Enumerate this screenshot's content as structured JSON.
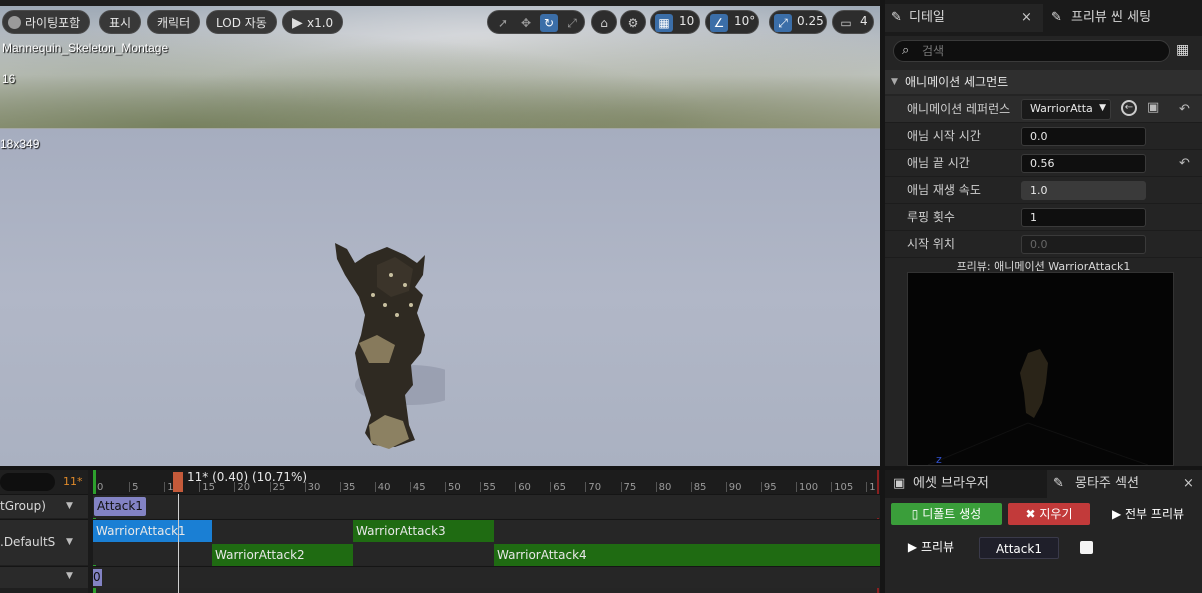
{
  "viewport": {
    "toolbar": {
      "lighting_label": "라이팅포함",
      "show_label": "표시",
      "character_label": "캐릭터",
      "lod_label": "LOD 자동",
      "play_speed": "x1.0",
      "grid_value": "10",
      "rotation_value": "10°",
      "scale_value": "0.25",
      "camera_value": "4"
    },
    "overlay": {
      "asset_name": "Mannequin_Skeleton_Montage",
      "frame_text": "16",
      "resolution_text": "18x349"
    }
  },
  "details_panel": {
    "tabs": [
      {
        "label": "디테일",
        "close": "×"
      },
      {
        "label": "프리뷰 씬 세팅"
      }
    ],
    "search_placeholder": "검색",
    "section_title": "애니메이션 세그먼트",
    "properties": [
      {
        "label": "애니메이션 레퍼런스",
        "value": "WarriorAtta"
      },
      {
        "label": "애님 시작 시간",
        "value": "0.0"
      },
      {
        "label": "애님 끝 시간",
        "value": "0.56"
      },
      {
        "label": "애님 재생 속도",
        "value": "1.0"
      },
      {
        "label": "루핑 횟수",
        "value": "1"
      },
      {
        "label": "시작 위치",
        "value": "0.0"
      }
    ],
    "preview_title": "프리뷰: 애니메이션 WarriorAttack1"
  },
  "timeline": {
    "search_count": "11*",
    "playhead_label": "11* (0.40) (10.71%)",
    "ticks": [
      "0",
      "5",
      "10",
      "15",
      "20",
      "25",
      "30",
      "35",
      "40",
      "45",
      "50",
      "55",
      "60",
      "65",
      "70",
      "75",
      "80",
      "85",
      "90",
      "95",
      "100",
      "105",
      "1"
    ],
    "rows": [
      {
        "label": "tGroup)"
      },
      {
        "label": ".DefaultS"
      },
      {
        "label": ""
      }
    ],
    "section_clip": "Attack1",
    "clips": [
      {
        "label": "WarriorAttack1",
        "color": "#1a7fd4"
      },
      {
        "label": "WarriorAttack2",
        "color": "#1f6b12"
      },
      {
        "label": "WarriorAttack3",
        "color": "#1f6b12"
      },
      {
        "label": "WarriorAttack4",
        "color": "#1f6b12"
      }
    ],
    "notify_marker": "0"
  },
  "bottom_panel": {
    "tabs": [
      {
        "label": "에셋 브라우저"
      },
      {
        "label": "몽타주 섹션",
        "close": "×"
      }
    ],
    "create_default_label": "디폴트 생성",
    "clear_label": "지우기",
    "preview_all_label": "전부 프리뷰",
    "preview_label": "프리뷰",
    "section_name": "Attack1"
  },
  "colors": {
    "accent_blue": "#1a7fd4",
    "clip_green": "#1f6b12",
    "create_green": "#3a9e3a",
    "clear_red": "#c23a3a"
  }
}
